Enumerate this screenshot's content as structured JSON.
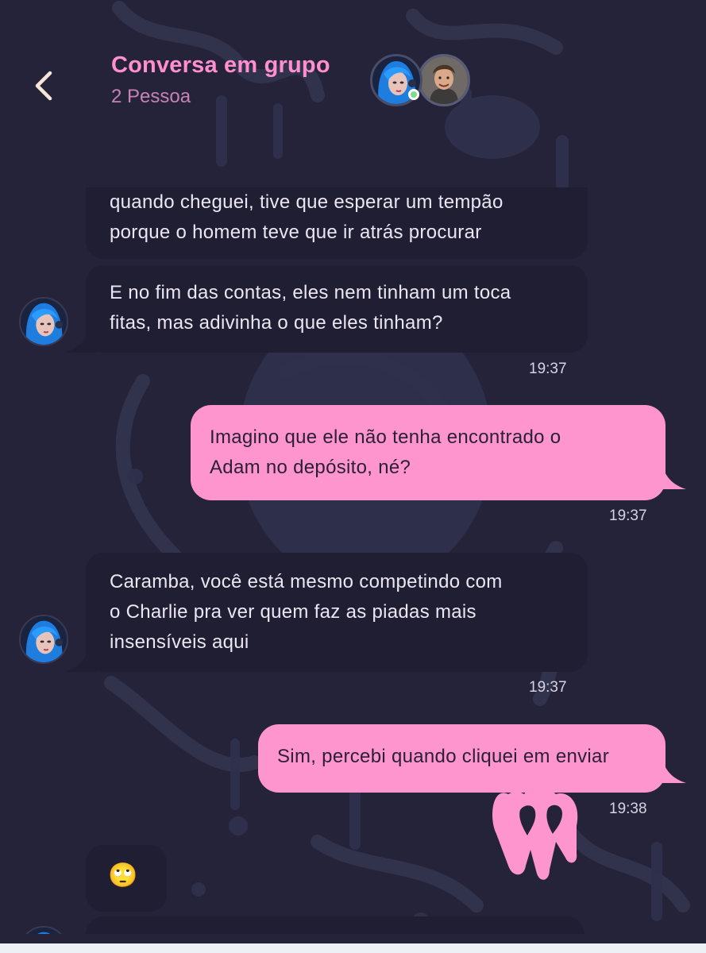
{
  "header": {
    "title": "Conversa em grupo",
    "subtitle": "2 Pessoa"
  },
  "messages": [
    {
      "from": "other",
      "lines": [
        "quando cheguei, tive que esperar um tempão",
        "porque o homem teve que ir atrás procurar"
      ]
    },
    {
      "from": "other",
      "lines": [
        "E no fim das contas, eles nem tinham um toca",
        "fitas, mas adivinha o que eles tinham?"
      ],
      "time": "19:37"
    },
    {
      "from": "me",
      "lines": [
        "Imagino que ele não tenha encontrado o",
        "Adam no depósito, né?"
      ],
      "time": "19:37"
    },
    {
      "from": "other",
      "lines": [
        "Caramba, você está mesmo competindo com",
        "o Charlie pra ver quem faz as piadas mais",
        "insensíveis aqui"
      ],
      "time": "19:37"
    },
    {
      "from": "me",
      "lines": [
        "Sim, percebi quando cliquei em enviar"
      ],
      "time": "19:38"
    },
    {
      "from": "other",
      "emoji": "🙄"
    }
  ],
  "colors": {
    "background": "#25233a",
    "incoming_bubble": "#1f1e33",
    "outgoing_bubble": "#ff95cf",
    "accent": "#ff8fce"
  },
  "icons": {
    "back": "chevron-left-icon",
    "online": "online-dot-icon"
  }
}
